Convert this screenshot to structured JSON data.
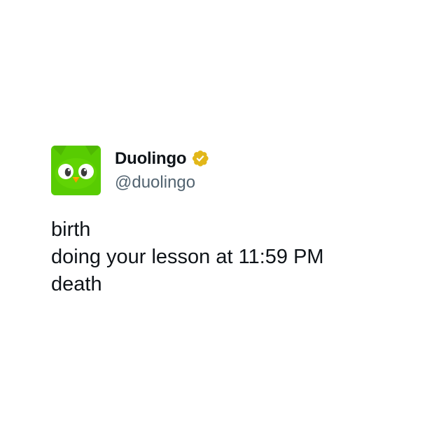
{
  "account": {
    "display_name": "Duolingo",
    "handle": "@duolingo",
    "verified_badge_icon": "gold-verified-badge-icon",
    "avatar_icon": "duolingo-owl-icon",
    "avatar_color": "#58cc02",
    "badge_color": "#e2b719"
  },
  "tweet": {
    "lines": [
      "birth",
      "doing your lesson at 11:59 PM",
      "death"
    ]
  }
}
